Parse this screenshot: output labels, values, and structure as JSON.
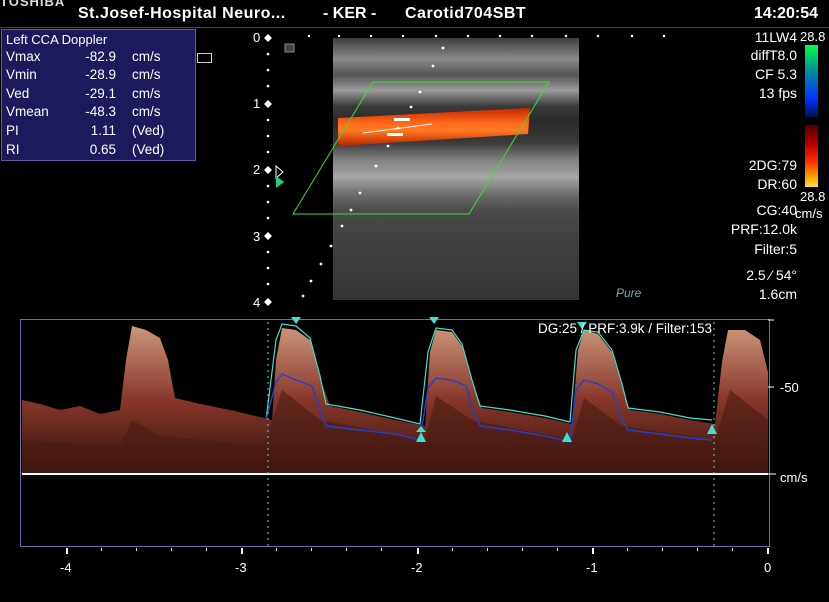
{
  "header": {
    "logo": "TOSHIBA",
    "hospital": "St.Josef-Hospital Neuro...",
    "dept": "- KER -",
    "study": "Carotid704SBT",
    "time": "14:20:54"
  },
  "measurements": {
    "title": "Left CCA Doppler",
    "rows": [
      {
        "label": "Vmax",
        "value": "-82.9",
        "unit": "cm/s"
      },
      {
        "label": "Vmin",
        "value": "-28.9",
        "unit": "cm/s"
      },
      {
        "label": "Ved",
        "value": "-29.1",
        "unit": "cm/s"
      },
      {
        "label": "Vmean",
        "value": "-48.3",
        "unit": "cm/s"
      },
      {
        "label": "PI",
        "value": "1.11",
        "unit": "(Ved)"
      },
      {
        "label": "RI",
        "value": "0.65",
        "unit": "(Ved)"
      }
    ]
  },
  "probe_info": {
    "probe": "11LW4",
    "mode": "diffT8.0",
    "cf": "CF 5.3",
    "fps": "13 fps",
    "dg": "2DG:79",
    "dr": "DR:60",
    "cg": "CG:40",
    "prf": "PRF:12.0k",
    "filter": "Filter:5",
    "angle": "2.5 ∕ 54°",
    "depth": "1.6cm"
  },
  "color_bar": {
    "top": "28.8",
    "bottom": "28.8",
    "unit": "cm/s",
    "colors": {
      "pos_top": "#00ff4a",
      "pos_mid": "#0050ff",
      "neg_top": "#ff1a00",
      "neg_bottom": "#ffdd33"
    }
  },
  "brand": "Pure",
  "depth_scale": [
    "0",
    "1",
    "2",
    "3",
    "4"
  ],
  "spectrum": {
    "info": "DG:25 /   PRF:3.9k   / Filter:153",
    "scale_label": "-50",
    "unit": "cm/s",
    "time_ticks": [
      "-4",
      "-3",
      "-2",
      "-1",
      "0"
    ]
  }
}
